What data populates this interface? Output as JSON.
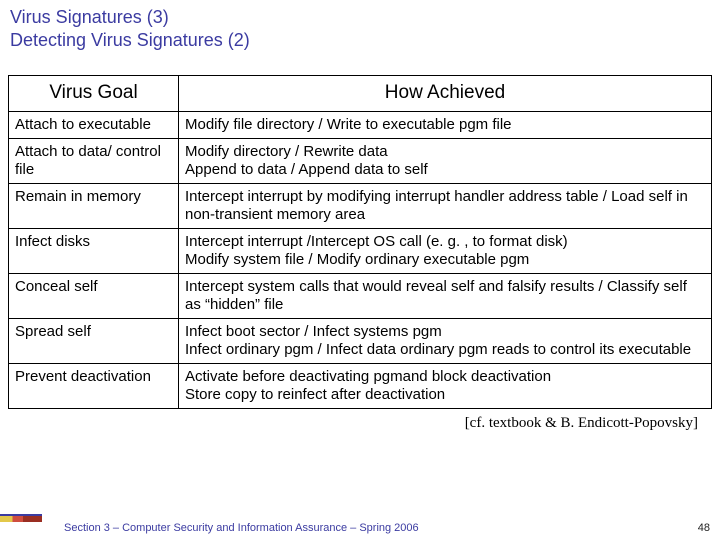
{
  "title_line1": "Virus Signatures (3)",
  "title_line2": "Detecting Virus Signatures (2)",
  "chart_data": {
    "type": "table",
    "headers": [
      "Virus Goal",
      "How Achieved"
    ],
    "rows": [
      {
        "goal": "Attach to executable",
        "how": "Modify file directory / Write to executable pgm file"
      },
      {
        "goal": "Attach to data/ control file",
        "how": "Modify directory / Rewrite data\nAppend to data / Append data to self"
      },
      {
        "goal": "Remain in memory",
        "how": "Intercept interrupt by modifying interrupt handler address table / Load self in non-transient memory area"
      },
      {
        "goal": "Infect disks",
        "how": "Intercept interrupt /Intercept OS call (e. g. , to format disk)\nModify system file / Modify ordinary executable pgm"
      },
      {
        "goal": "Conceal self",
        "how": "Intercept system calls that would reveal self and falsify results / Classify self as “hidden” file"
      },
      {
        "goal": "Spread self",
        "how": "Infect boot sector / Infect systems pgm\nInfect ordinary pgm / Infect data ordinary pgm reads to control its executable"
      },
      {
        "goal": "Prevent deactivation",
        "how": "Activate before deactivating pgmand block deactivation\nStore copy to reinfect after deactivation"
      }
    ]
  },
  "citation": "[cf. textbook & B. Endicott-Popovsky]",
  "footer_text": "Section 3 – Computer Security and Information Assurance – Spring 2006",
  "page_number": "48"
}
